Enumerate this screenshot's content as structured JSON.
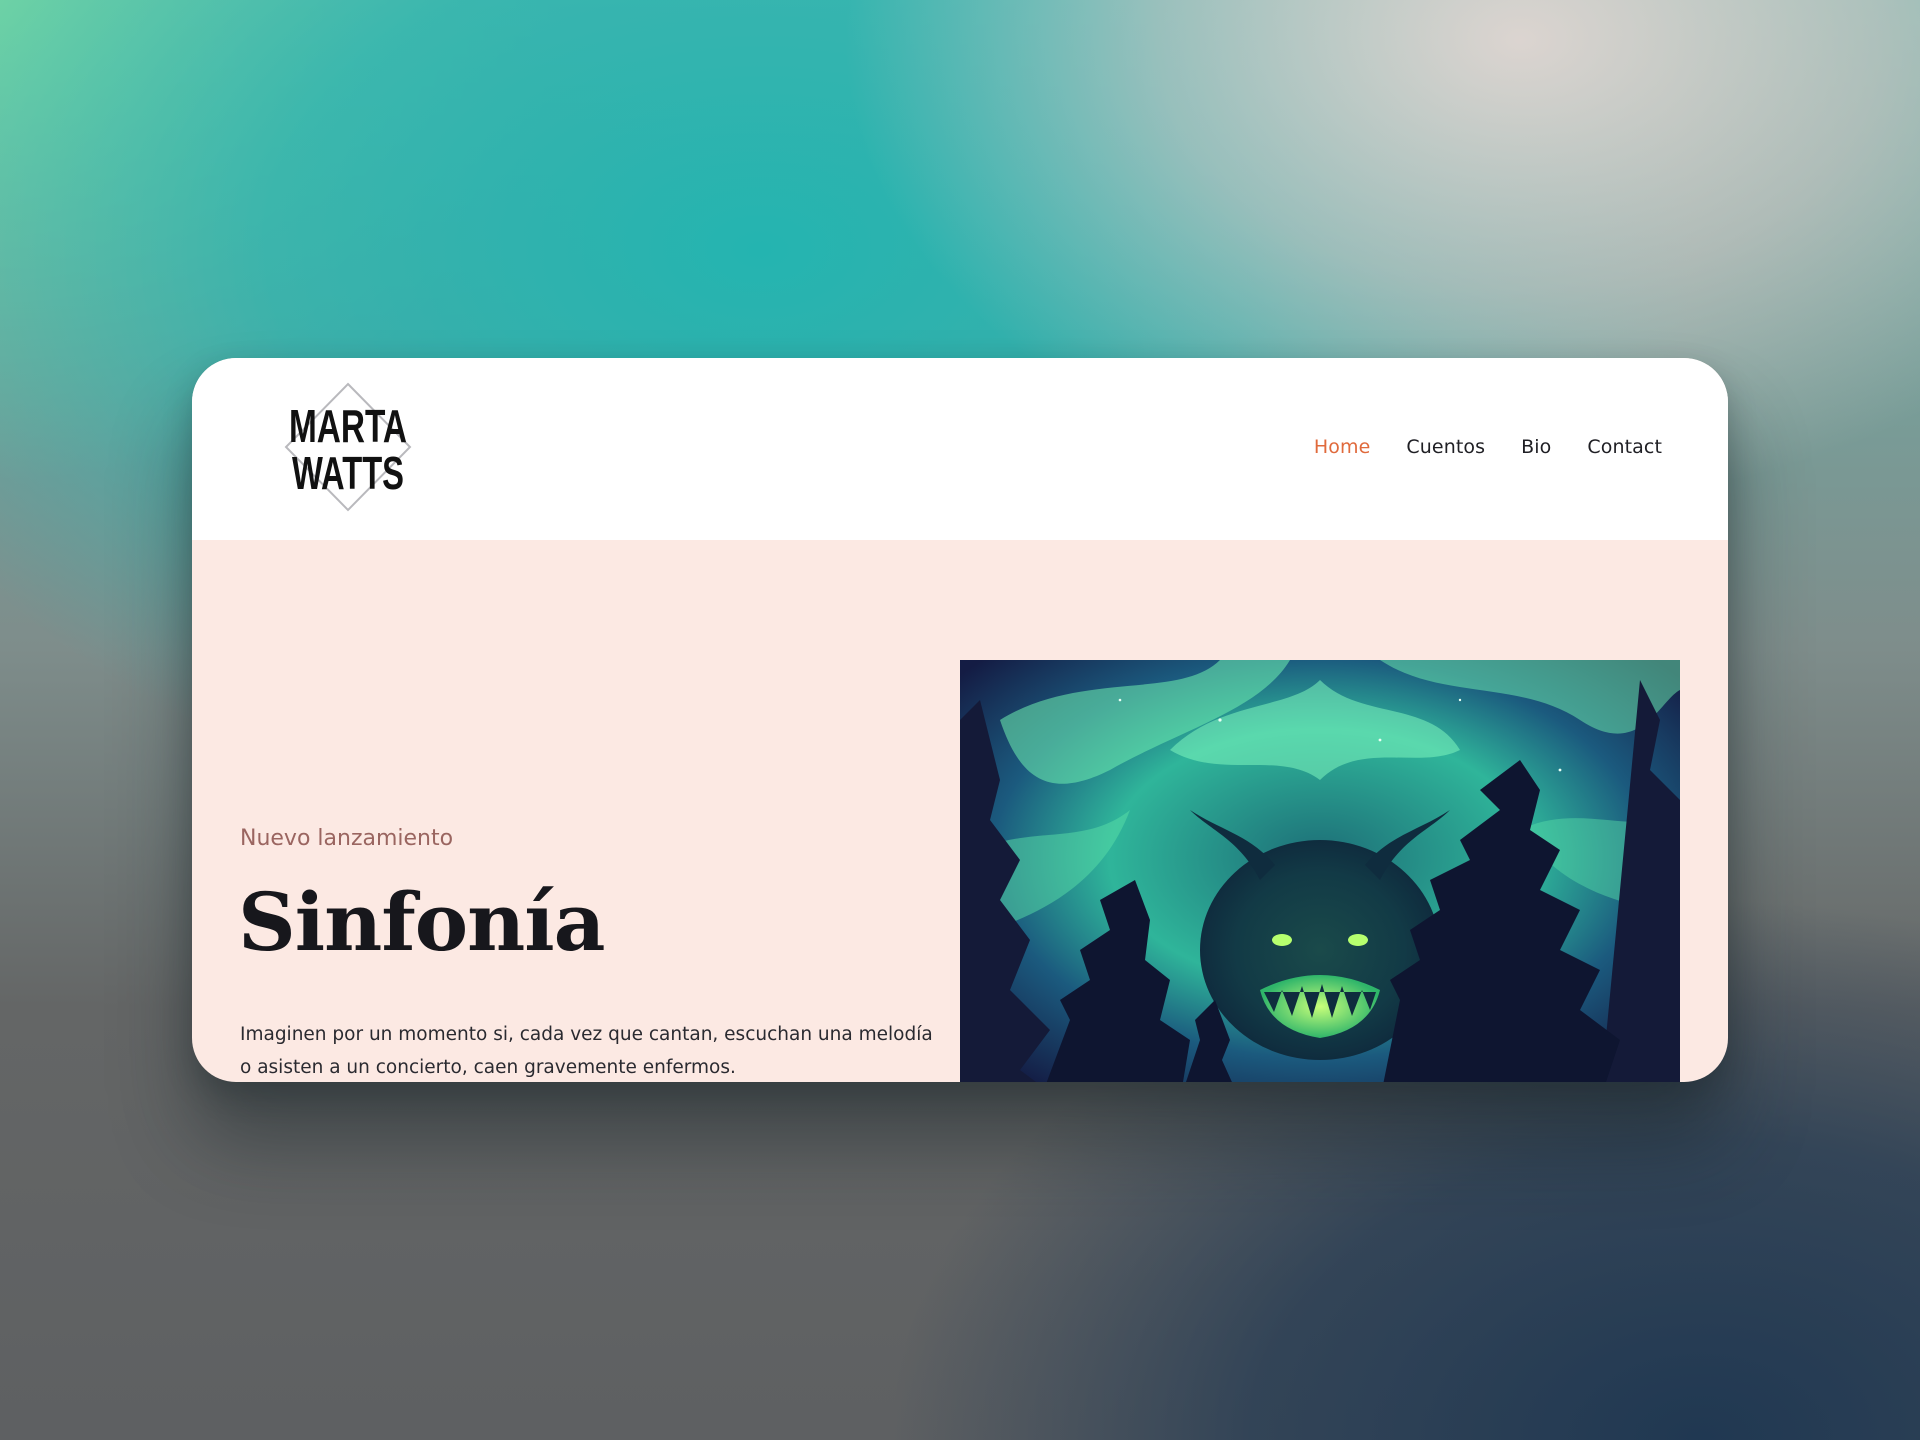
{
  "site": {
    "logo": {
      "line1": "MARTA",
      "line2": "WATTS",
      "icon": "diamond-logo-icon"
    },
    "nav": {
      "items": [
        {
          "label": "Home",
          "active": true
        },
        {
          "label": "Cuentos",
          "active": false
        },
        {
          "label": "Bio",
          "active": false
        },
        {
          "label": "Contact",
          "active": false
        }
      ]
    }
  },
  "hero": {
    "eyebrow": "Nuevo lanzamiento",
    "title": "Sinfonía",
    "description": "Imaginen por un momento si, cada vez que cantan, escuchan una melodía o asisten a un concierto, caen gravemente enfermos.",
    "image_icon": "forest-monster-illustration"
  },
  "colors": {
    "accent": "#e06a3c",
    "hero_background": "#fce9e3",
    "eyebrow": "#9a6560",
    "text_dark": "#17171c"
  }
}
